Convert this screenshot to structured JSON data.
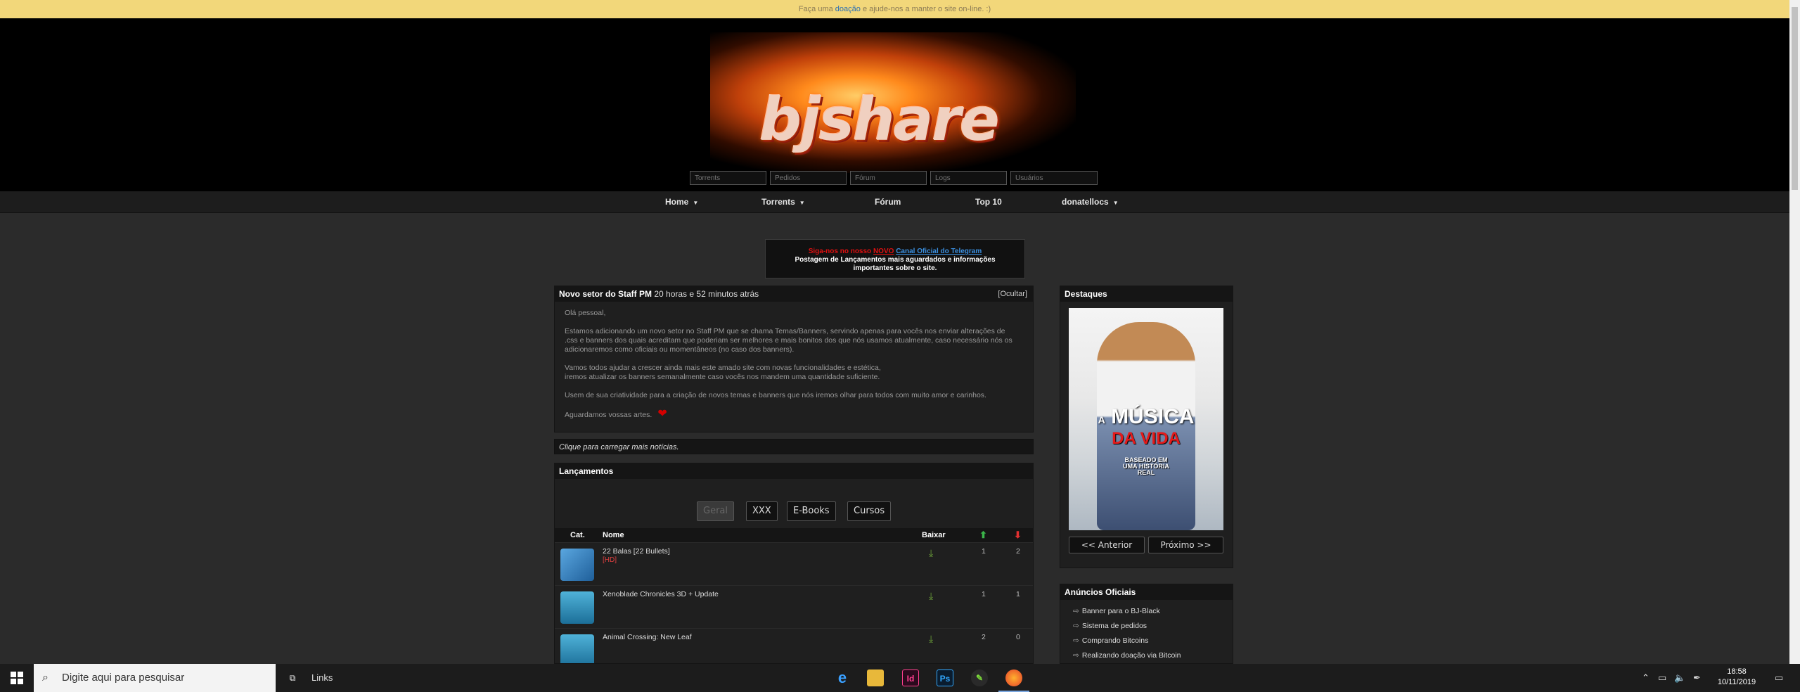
{
  "donation_bar": {
    "before": "Faça uma ",
    "link": "doação",
    "after": " e ajude-nos a manter o site on-line. :)"
  },
  "logo": {
    "text": "bjshare"
  },
  "header_search": {
    "torrents_placeholder": "Torrents",
    "pedidos_placeholder": "Pedidos",
    "forum_placeholder": "Fórum",
    "logs_placeholder": "Logs",
    "usuarios_placeholder": "Usuários"
  },
  "nav": {
    "home": "Home",
    "torrents": "Torrents",
    "forum": "Fórum",
    "top10": "Top 10",
    "user": "donatellocs"
  },
  "telegram": {
    "prefix": "Siga-nos no nosso ",
    "novo": "NOVO",
    "link": "Canal Oficial do Telegram",
    "line2": "Postagem de Lançamentos mais aguardados e informações",
    "line3": "importantes sobre o site."
  },
  "news": {
    "title": "Novo setor do Staff PM",
    "time": "20 horas e 52 minutos atrás",
    "hide": "[Ocultar]",
    "p1": "Olá pessoal,",
    "p2a": "Estamos adicionando um novo setor no Staff PM que se chama Temas/Banners, servindo apenas para vocês nos enviar alterações de",
    "p2b": ".css e banners dos quais acreditam que poderiam ser melhores e mais bonitos dos que nós usamos atualmente, caso necessário nós os",
    "p2c": "adicionaremos como oficiais ou momentâneos (no caso dos banners).",
    "p3a": "Vamos todos ajudar a crescer ainda mais este amado site com novas funcionalidades e estética,",
    "p3b": "iremos atualizar os banners semanalmente caso vocês nos mandem uma quantidade suficiente.",
    "p4": "Usem de sua criatividade para a criação de novos temas e banners que nós iremos olhar para todos com muito amor e carinhos.",
    "p5": "Aguardamos vossas artes."
  },
  "more_news": "Clique para carregar mais notícias.",
  "releases": {
    "title": "Lançamentos",
    "tabs": [
      "Geral",
      "XXX",
      "E-Books",
      "Cursos"
    ],
    "headers": {
      "cat": "Cat.",
      "name": "Nome",
      "download": "Baixar"
    },
    "rows": [
      {
        "name": "22 Balas [22 Bullets]",
        "tag": "[HD]",
        "seeders": "1",
        "leechers": "2"
      },
      {
        "name": "Xenoblade Chronicles 3D + Update",
        "tag": "",
        "seeders": "1",
        "leechers": "1"
      },
      {
        "name": "Animal Crossing: New Leaf",
        "tag": "",
        "seeders": "2",
        "leechers": "0"
      }
    ]
  },
  "highlights": {
    "title": "Destaques",
    "poster_small": "A",
    "poster_title": "MÚSICA",
    "poster_subtitle": "DA VIDA",
    "poster_caption1": "BASEADO EM",
    "poster_caption2": "UMA HISTÓRIA",
    "poster_caption3": "REAL",
    "prev": "<< Anterior",
    "next": "Próximo >>"
  },
  "ads": {
    "title": "Anúncios Oficiais",
    "items": [
      "Banner para o BJ-Black",
      "Sistema de pedidos",
      "Comprando Bitcoins",
      "Realizando doação via Bitcoin"
    ]
  },
  "taskbar": {
    "search_placeholder": "Digite aqui para pesquisar",
    "links": "Links",
    "time": "18:58",
    "date": "10/11/2019"
  },
  "colors": {
    "donation_bg": "#f2d77a",
    "header_bg": "#000000",
    "page_bg": "#2b2b2b",
    "panel_bg": "#1f1f1f",
    "alert_red": "#e01010",
    "link_blue": "#3a8fe0"
  }
}
